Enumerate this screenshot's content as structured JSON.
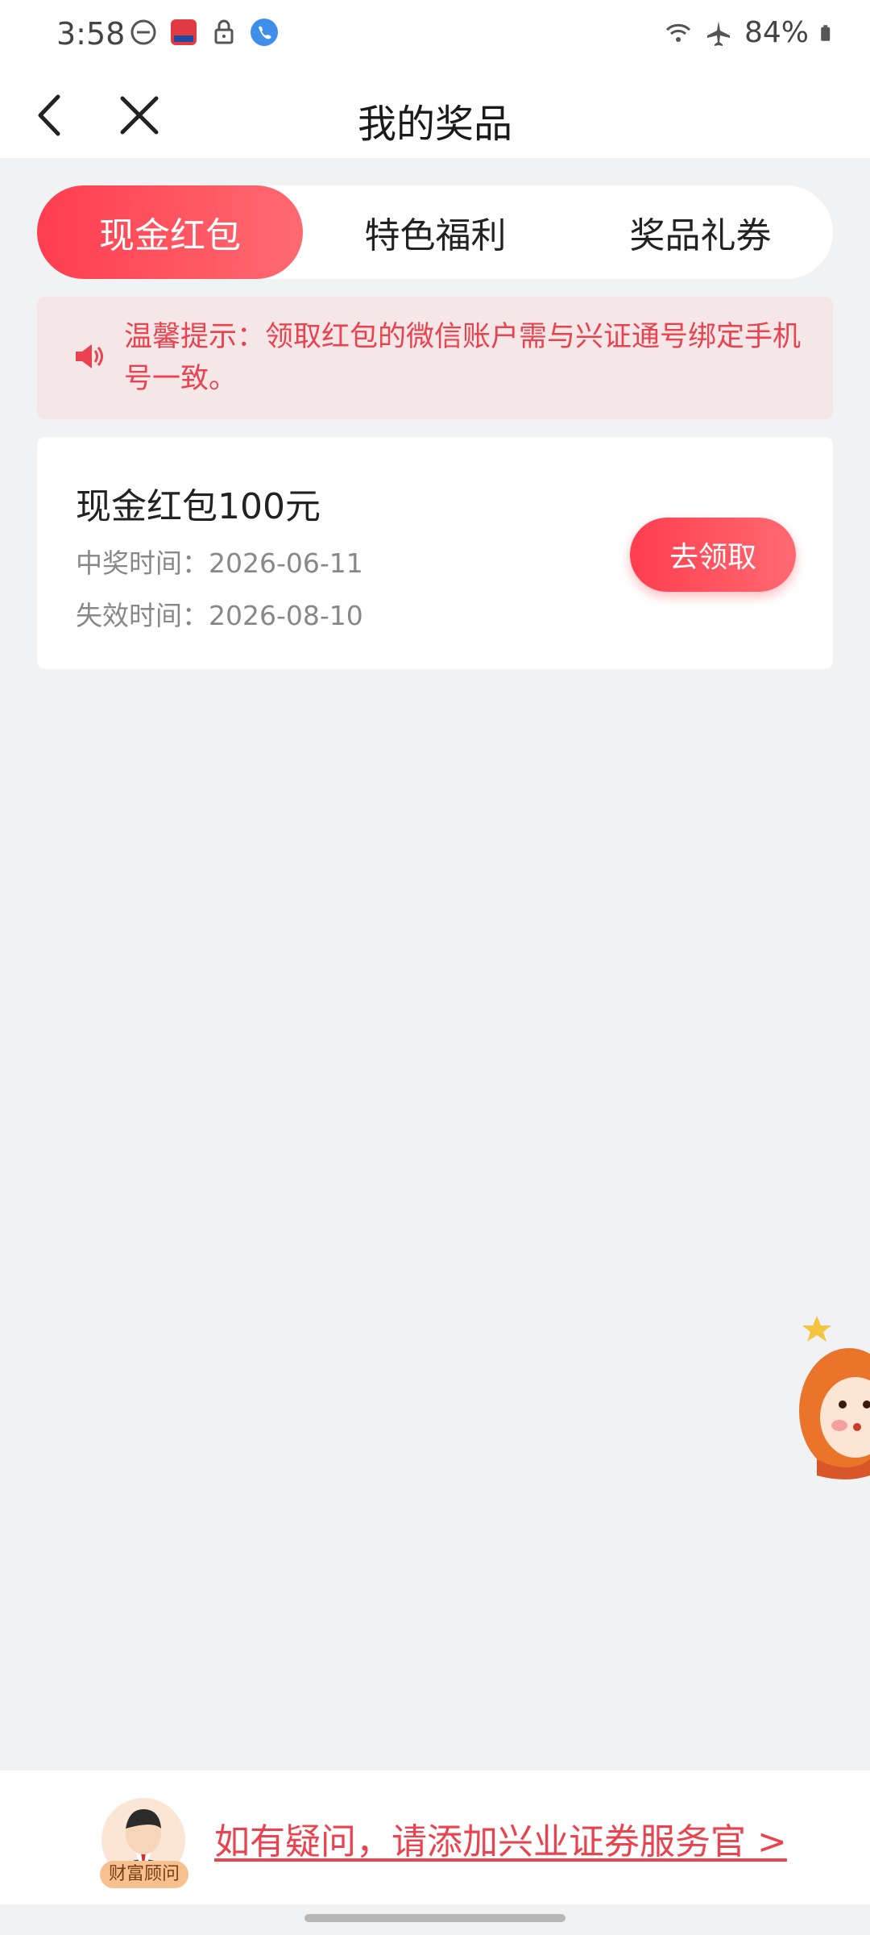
{
  "status_bar": {
    "time": "3:58",
    "battery": "84%",
    "icons": [
      "dnd-icon",
      "app-notification-icon",
      "lock-icon",
      "call-icon",
      "wifi-icon",
      "airplane-icon",
      "battery-icon"
    ]
  },
  "nav": {
    "title": "我的奖品",
    "back_icon": "chevron-left-icon",
    "close_icon": "close-icon"
  },
  "tabs": [
    {
      "label": "现金红包",
      "active": true
    },
    {
      "label": "特色福利",
      "active": false
    },
    {
      "label": "奖品礼券",
      "active": false
    }
  ],
  "tip": {
    "icon": "speaker-icon",
    "text": "温馨提示：领取红包的微信账户需与兴证通号绑定手机号一致。"
  },
  "prize": {
    "title": "现金红包100元",
    "win_time": "中奖时间：2026-06-11",
    "expire_time": "失效时间：2026-08-10",
    "claim_label": "去领取"
  },
  "footer": {
    "badge": "财富顾问",
    "link": "如有疑问，请添加兴业证券服务官 >"
  },
  "colors": {
    "accent": "#ff4a58",
    "tip_bg": "#f5e6e8",
    "page_bg": "#f1f2f4"
  }
}
